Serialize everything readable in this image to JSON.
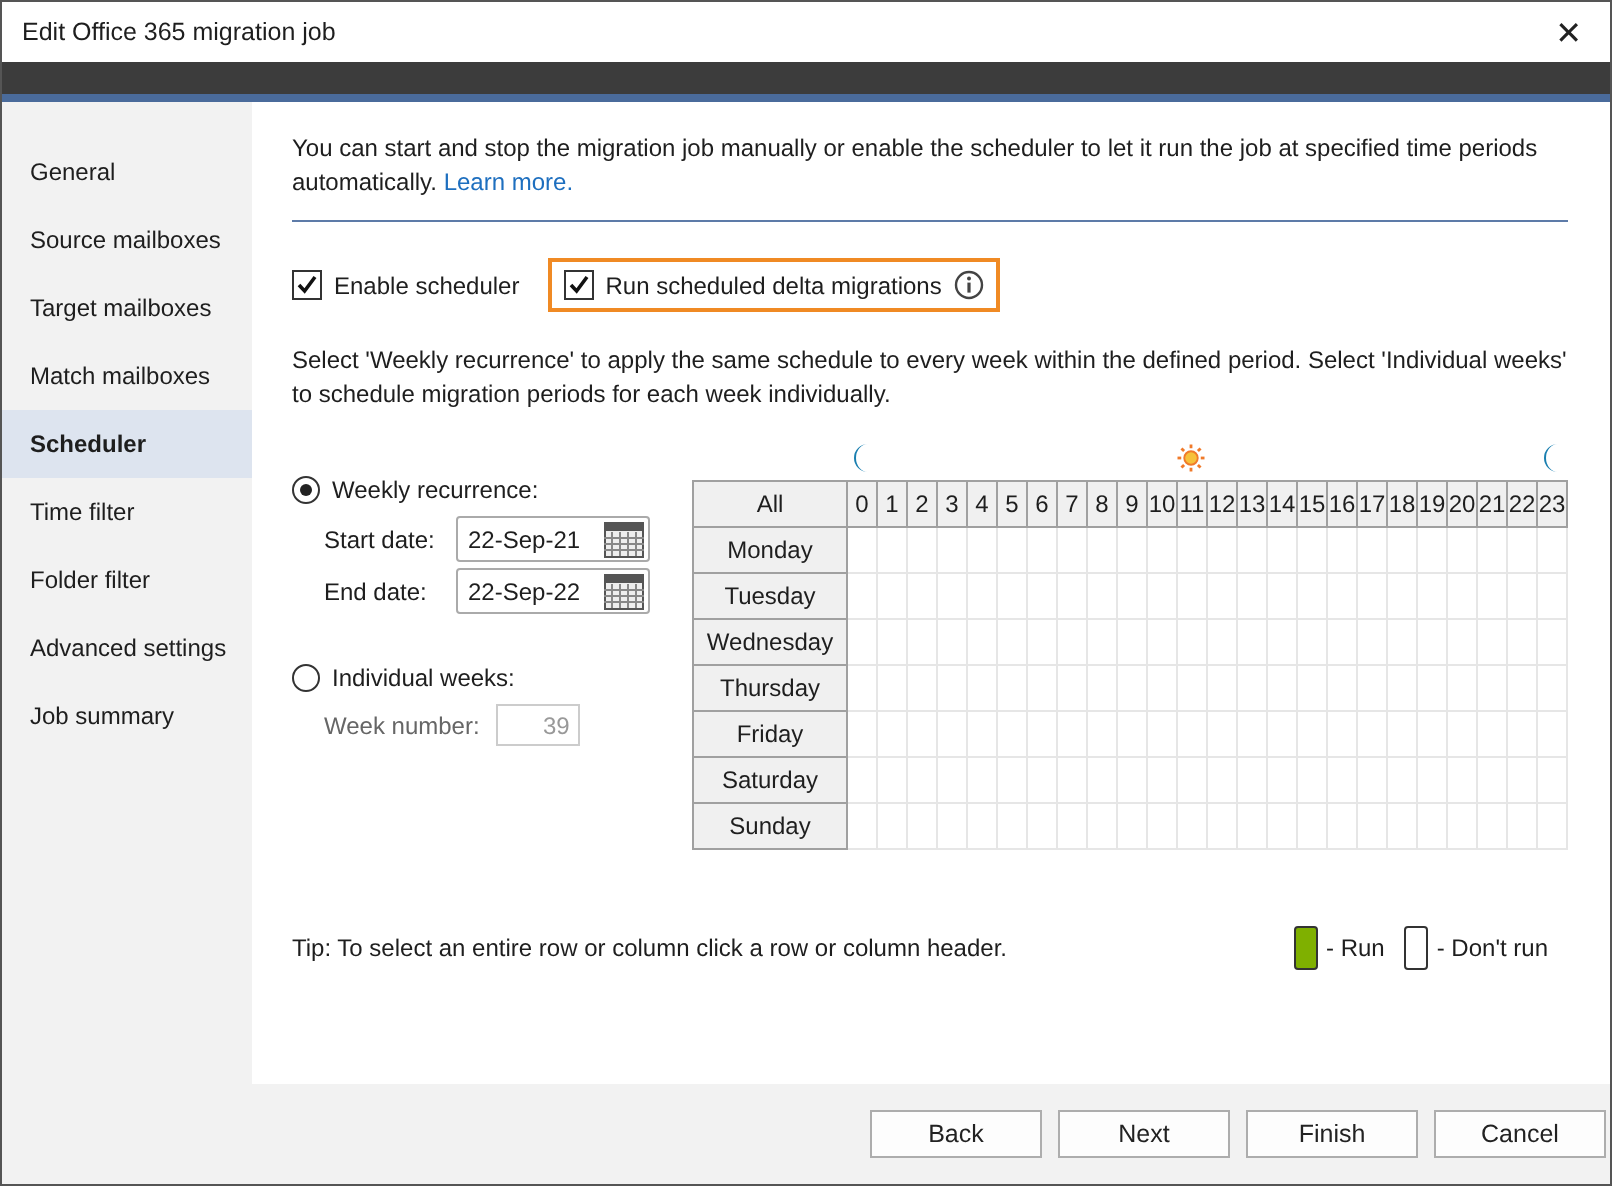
{
  "window": {
    "title": "Edit Office 365 migration job",
    "close": "✕"
  },
  "sidebar": {
    "items": [
      {
        "label": "General",
        "selected": false
      },
      {
        "label": "Source mailboxes",
        "selected": false
      },
      {
        "label": "Target mailboxes",
        "selected": false
      },
      {
        "label": "Match mailboxes",
        "selected": false
      },
      {
        "label": "Scheduler",
        "selected": true
      },
      {
        "label": "Time filter",
        "selected": false
      },
      {
        "label": "Folder filter",
        "selected": false
      },
      {
        "label": "Advanced settings",
        "selected": false
      },
      {
        "label": "Job summary",
        "selected": false
      }
    ]
  },
  "intro": {
    "text": "You can start and stop the migration job manually or enable the scheduler to let it run the job at specified time periods automatically.",
    "link": "Learn more."
  },
  "options": [
    {
      "label": "Enable scheduler",
      "checked": true,
      "highlighted": false,
      "info": false
    },
    {
      "label": "Run scheduled delta migrations",
      "checked": true,
      "highlighted": true,
      "info": true
    }
  ],
  "instructions": "Select 'Weekly recurrence' to apply the same schedule to every week within the defined period. Select 'Individual weeks' to schedule migration periods for each week individually.",
  "recurrence": [
    {
      "label": "Weekly recurrence:",
      "selected": true,
      "fields": [
        {
          "kind": "date",
          "label": "Start date:",
          "value": "22-Sep-21",
          "disabled": false
        },
        {
          "kind": "date",
          "label": "End date:",
          "value": "22-Sep-22",
          "disabled": false
        }
      ]
    },
    {
      "label": "Individual weeks:",
      "selected": false,
      "fields": [
        {
          "kind": "number",
          "label": "Week number:",
          "value": "39",
          "disabled": true
        }
      ]
    }
  ],
  "schedule": {
    "corner": "All",
    "hours": [
      "0",
      "1",
      "2",
      "3",
      "4",
      "5",
      "6",
      "7",
      "8",
      "9",
      "10",
      "11",
      "12",
      "13",
      "14",
      "15",
      "16",
      "17",
      "18",
      "19",
      "20",
      "21",
      "22",
      "23"
    ],
    "days": [
      "Monday",
      "Tuesday",
      "Wednesday",
      "Thursday",
      "Friday",
      "Saturday",
      "Sunday"
    ]
  },
  "tip": "Tip: To select an entire row or column click a row or column header.",
  "legend": [
    {
      "label": "- Run",
      "color": "#7fb000"
    },
    {
      "label": "- Don't run",
      "color": "#ffffff"
    }
  ],
  "buttons": [
    "Back",
    "Next",
    "Finish",
    "Cancel"
  ]
}
